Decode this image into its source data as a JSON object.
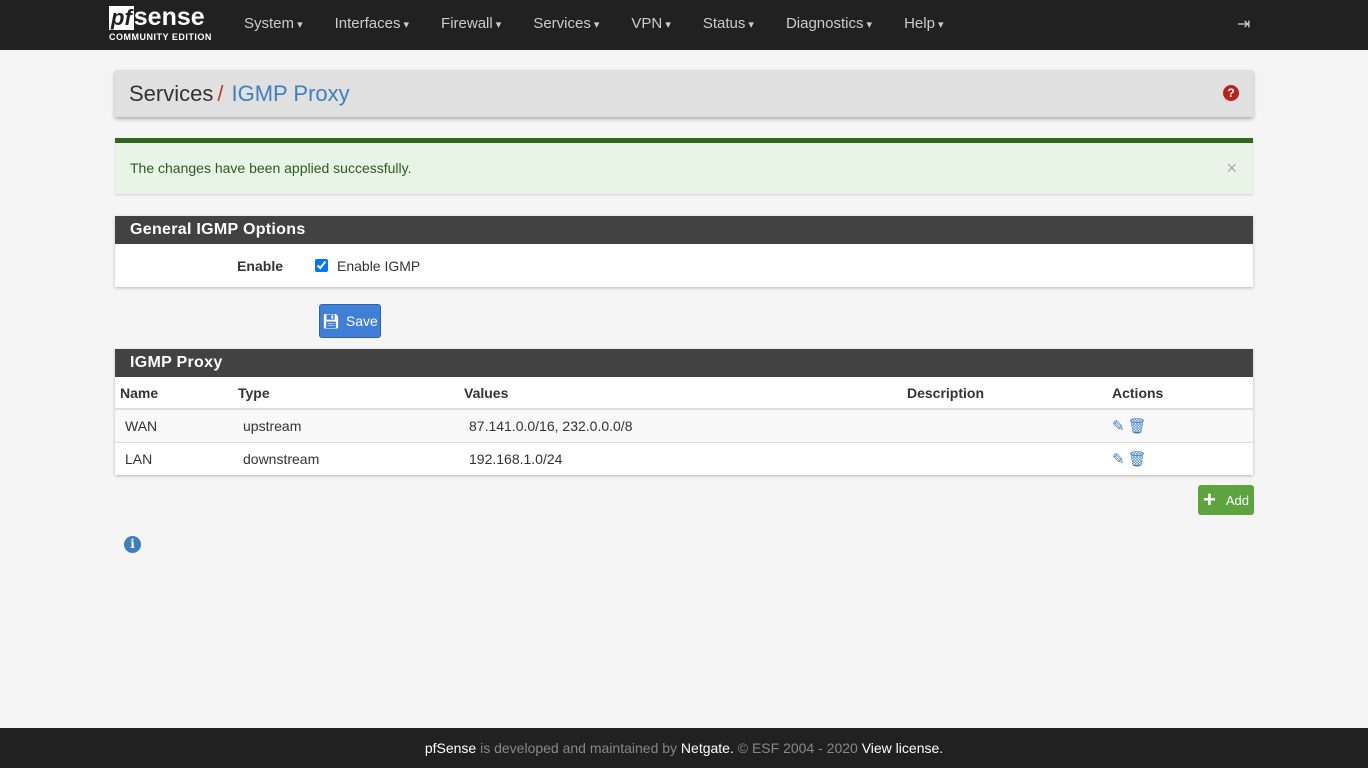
{
  "brand": {
    "logo_pf": "pf",
    "logo_sense": "sense",
    "edition": "COMMUNITY EDITION"
  },
  "nav": [
    "System",
    "Interfaces",
    "Firewall",
    "Services",
    "VPN",
    "Status",
    "Diagnostics",
    "Help"
  ],
  "breadcrumb": {
    "parent": "Services",
    "separator": "/",
    "current": "IGMP Proxy"
  },
  "alert": {
    "message": "The changes have been applied successfully.",
    "close": "×"
  },
  "general": {
    "title": "General IGMP Options",
    "enable_label": "Enable",
    "checkbox_label": "Enable IGMP",
    "checked": true,
    "save_label": "Save"
  },
  "proxy": {
    "title": "IGMP Proxy",
    "columns": [
      "Name",
      "Type",
      "Values",
      "Description",
      "Actions"
    ],
    "rows": [
      {
        "name": "WAN",
        "type": "upstream",
        "values": "87.141.0.0/16, 232.0.0.0/8",
        "description": ""
      },
      {
        "name": "LAN",
        "type": "downstream",
        "values": "192.168.1.0/24",
        "description": ""
      }
    ],
    "add_label": "Add"
  },
  "footer": {
    "brand": "pfSense",
    "text1": " is developed and maintained by ",
    "company": "Netgate.",
    "text2": " © ESF 2004 - 2020 ",
    "license": "View license."
  }
}
